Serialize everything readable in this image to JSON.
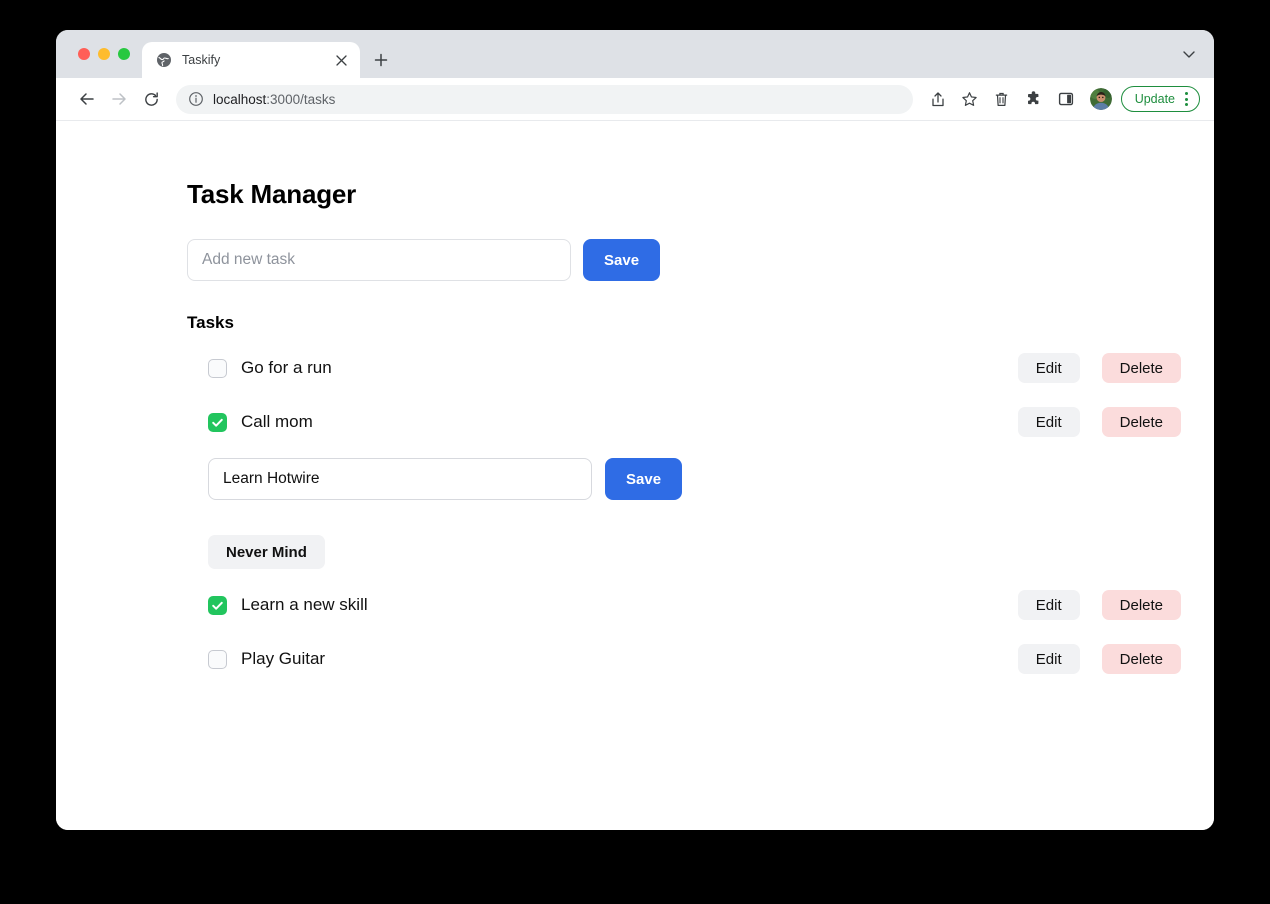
{
  "browser": {
    "tab": {
      "title": "Taskify",
      "favicon_icon": "globe-icon",
      "close_icon": "close-icon"
    },
    "new_tab_icon": "plus-icon",
    "tab_list_chevron_icon": "chevron-down-icon",
    "nav": {
      "back_icon": "arrow-left-icon",
      "forward_icon": "arrow-right-icon",
      "reload_icon": "reload-icon"
    },
    "omnibox": {
      "info_icon": "info-circle-icon",
      "host": "localhost",
      "path": ":3000/tasks",
      "url": "localhost:3000/tasks"
    },
    "toolbar_icons": [
      "share-icon",
      "bookmark-star-icon",
      "trash-icon",
      "extensions-puzzle-icon",
      "side-panel-icon"
    ],
    "avatar_icon": "user-avatar",
    "update_button": {
      "label": "Update",
      "menu_icon": "three-dots-vertical-icon",
      "color": "#1e8e3e"
    }
  },
  "page": {
    "title": "Task Manager",
    "add_form": {
      "placeholder": "Add new task",
      "value": "",
      "save_label": "Save"
    },
    "section_title": "Tasks",
    "tasks": [
      {
        "label": "Go for a run",
        "checked": false,
        "edit_label": "Edit",
        "delete_label": "Delete"
      },
      {
        "label": "Call mom",
        "checked": true,
        "edit_label": "Edit",
        "delete_label": "Delete"
      },
      {
        "label": "Learn a new skill",
        "checked": true,
        "edit_label": "Edit",
        "delete_label": "Delete"
      },
      {
        "label": "Play Guitar",
        "checked": false,
        "edit_label": "Edit",
        "delete_label": "Delete"
      }
    ],
    "editing": {
      "value": "Learn Hotwire",
      "save_label": "Save",
      "cancel_label": "Never Mind"
    }
  },
  "colors": {
    "primary": "#2f6ce5",
    "checkbox_checked": "#22c55e",
    "delete_bg": "#fbdcdc",
    "edit_bg": "#f1f2f4",
    "update_green": "#1e8e3e"
  }
}
